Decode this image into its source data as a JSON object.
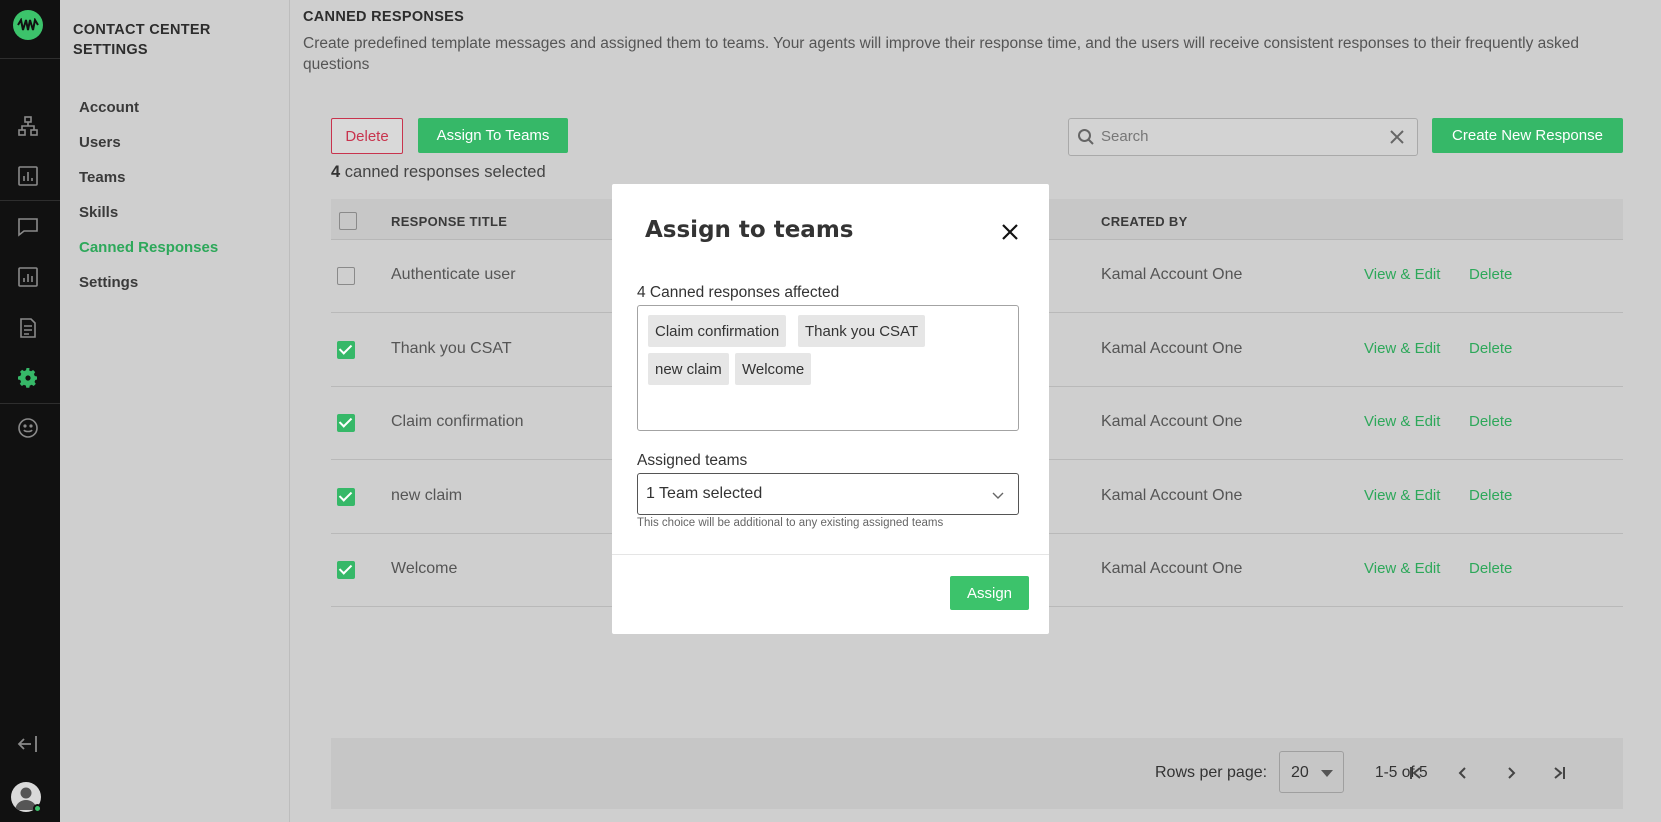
{
  "sidebar": {
    "title": "CONTACT CENTER SETTINGS",
    "items": [
      {
        "label": "Account",
        "active": false
      },
      {
        "label": "Users",
        "active": false
      },
      {
        "label": "Teams",
        "active": false
      },
      {
        "label": "Skills",
        "active": false
      },
      {
        "label": "Canned Responses",
        "active": true
      },
      {
        "label": "Settings",
        "active": false
      }
    ]
  },
  "rail": {
    "icons": [
      "logo-icon",
      "org-chart-icon",
      "bar-chart-icon",
      "chat-icon",
      "report-icon",
      "document-icon",
      "gear-icon",
      "smiley-icon",
      "logout-icon",
      "avatar-icon"
    ],
    "accent": "#3cc36b"
  },
  "page": {
    "title": "CANNED RESPONSES",
    "description": "Create predefined template messages and assigned them to teams. Your agents will improve their response time, and the users will receive consistent responses to their frequently asked questions"
  },
  "toolbar": {
    "delete_label": "Delete",
    "assign_label": "Assign To Teams",
    "create_label": "Create New Response",
    "search_placeholder": "Search"
  },
  "selection": {
    "count": "4",
    "text": " canned responses selected"
  },
  "table": {
    "columns": [
      "RESPONSE TITLE",
      "CREATED BY"
    ],
    "rows": [
      {
        "title": "Authenticate user",
        "created_by": "Kamal Account One",
        "checked": false,
        "view": "View & Edit",
        "delete": "Delete"
      },
      {
        "title": "Thank you CSAT",
        "created_by": "Kamal Account One",
        "checked": true,
        "view": "View & Edit",
        "delete": "Delete"
      },
      {
        "title": "Claim confirmation",
        "created_by": "Kamal Account One",
        "checked": true,
        "view": "View & Edit",
        "delete": "Delete"
      },
      {
        "title": "new claim",
        "created_by": "Kamal Account One",
        "checked": true,
        "view": "View & Edit",
        "delete": "Delete"
      },
      {
        "title": "Welcome",
        "created_by": "Kamal Account One",
        "checked": true,
        "view": "View & Edit",
        "delete": "Delete"
      }
    ]
  },
  "pagination": {
    "rows_per_page_label": "Rows per page:",
    "rows_per_page": "20",
    "range": "1-5 of 5"
  },
  "modal": {
    "title": "Assign to teams",
    "affected_label": "4 Canned responses affected",
    "chips": [
      "Claim confirmation",
      "Thank you CSAT",
      "new claim",
      "Welcome"
    ],
    "assigned_label": "Assigned teams",
    "select_value": "1 Team selected",
    "hint": "This choice will be additional to any existing assigned teams",
    "assign_button": "Assign"
  },
  "colors": {
    "accent_green": "#36b868",
    "danger": "#c8334d"
  }
}
